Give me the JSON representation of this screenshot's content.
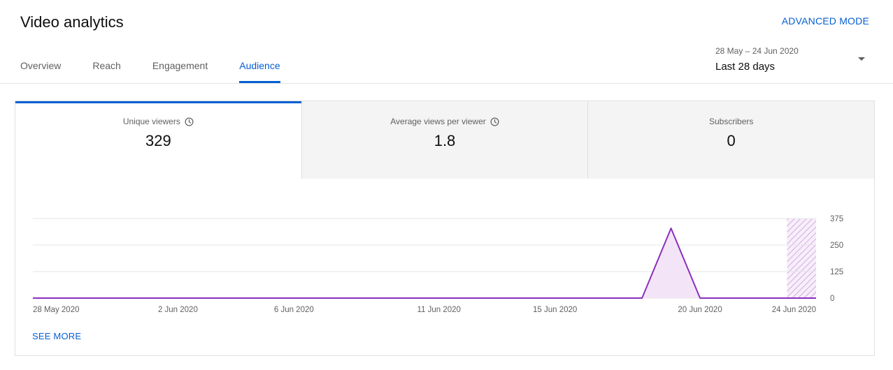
{
  "header": {
    "title": "Video analytics",
    "advanced_mode_label": "ADVANCED MODE"
  },
  "tabs": [
    {
      "label": "Overview",
      "active": false
    },
    {
      "label": "Reach",
      "active": false
    },
    {
      "label": "Engagement",
      "active": false
    },
    {
      "label": "Audience",
      "active": true
    }
  ],
  "date_picker": {
    "range": "28 May – 24 Jun 2020",
    "label": "Last 28 days"
  },
  "metrics": [
    {
      "label": "Unique viewers",
      "value": "329",
      "has_info_icon": true,
      "active": true
    },
    {
      "label": "Average views per viewer",
      "value": "1.8",
      "has_info_icon": true,
      "active": false
    },
    {
      "label": "Subscribers",
      "value": "0",
      "has_info_icon": false,
      "active": false
    }
  ],
  "see_more_label": "SEE MORE",
  "colors": {
    "accent": "#065fd4",
    "series_line": "#8c2fbf",
    "series_fill": "#f3e5f7",
    "grid": "#e5e5e5"
  },
  "chart_data": {
    "type": "area",
    "x_tick_labels": [
      "28 May 2020",
      "2 Jun 2020",
      "6 Jun 2020",
      "11 Jun 2020",
      "15 Jun 2020",
      "20 Jun 2020",
      "24 Jun 2020"
    ],
    "x_tick_days": [
      0,
      5,
      9,
      14,
      18,
      23,
      27
    ],
    "y_ticks": [
      0,
      125,
      250,
      375
    ],
    "ylim": [
      0,
      375
    ],
    "series": [
      {
        "values": [
          0,
          0,
          0,
          0,
          0,
          0,
          0,
          0,
          0,
          0,
          0,
          0,
          0,
          0,
          0,
          0,
          0,
          0,
          0,
          0,
          0,
          0,
          329,
          0,
          0,
          0,
          0,
          0
        ]
      }
    ],
    "partial_last_day": true,
    "grid": true
  }
}
